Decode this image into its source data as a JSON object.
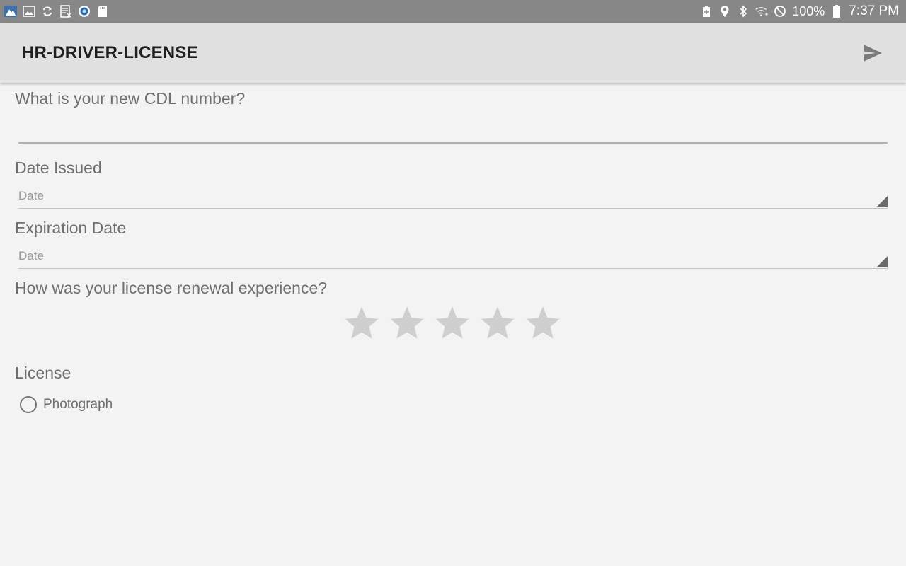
{
  "status_bar": {
    "left_icons": [
      "maps-icon",
      "image-icon",
      "sync-icon",
      "document-icon",
      "vpn-icon",
      "sd-card-icon"
    ],
    "right_icons": [
      "battery-saver-icon",
      "location-icon",
      "bluetooth-icon",
      "wifi-icon",
      "do-not-disturb-icon"
    ],
    "battery": "100%",
    "time": "7:37 PM"
  },
  "app_bar": {
    "title": "HR-DRIVER-LICENSE",
    "send_icon": "send-icon"
  },
  "form": {
    "cdl_question": "What is your new CDL number?",
    "cdl_value": "",
    "date_issued_label": "Date Issued",
    "date_issued_placeholder": "Date",
    "expiration_label": "Expiration Date",
    "expiration_placeholder": "Date",
    "rating_question": "How was your license renewal experience?",
    "rating": {
      "max": 5,
      "value": 0
    },
    "license_label": "License",
    "license_option": "Photograph",
    "license_selected": false
  },
  "colors": {
    "status_bar": "#878787",
    "app_bar": "#e0e0e0",
    "background": "#f3f3f3",
    "title": "#1f1f1f",
    "label": "#6f6f6f",
    "star_empty": "#cfcfcf"
  }
}
